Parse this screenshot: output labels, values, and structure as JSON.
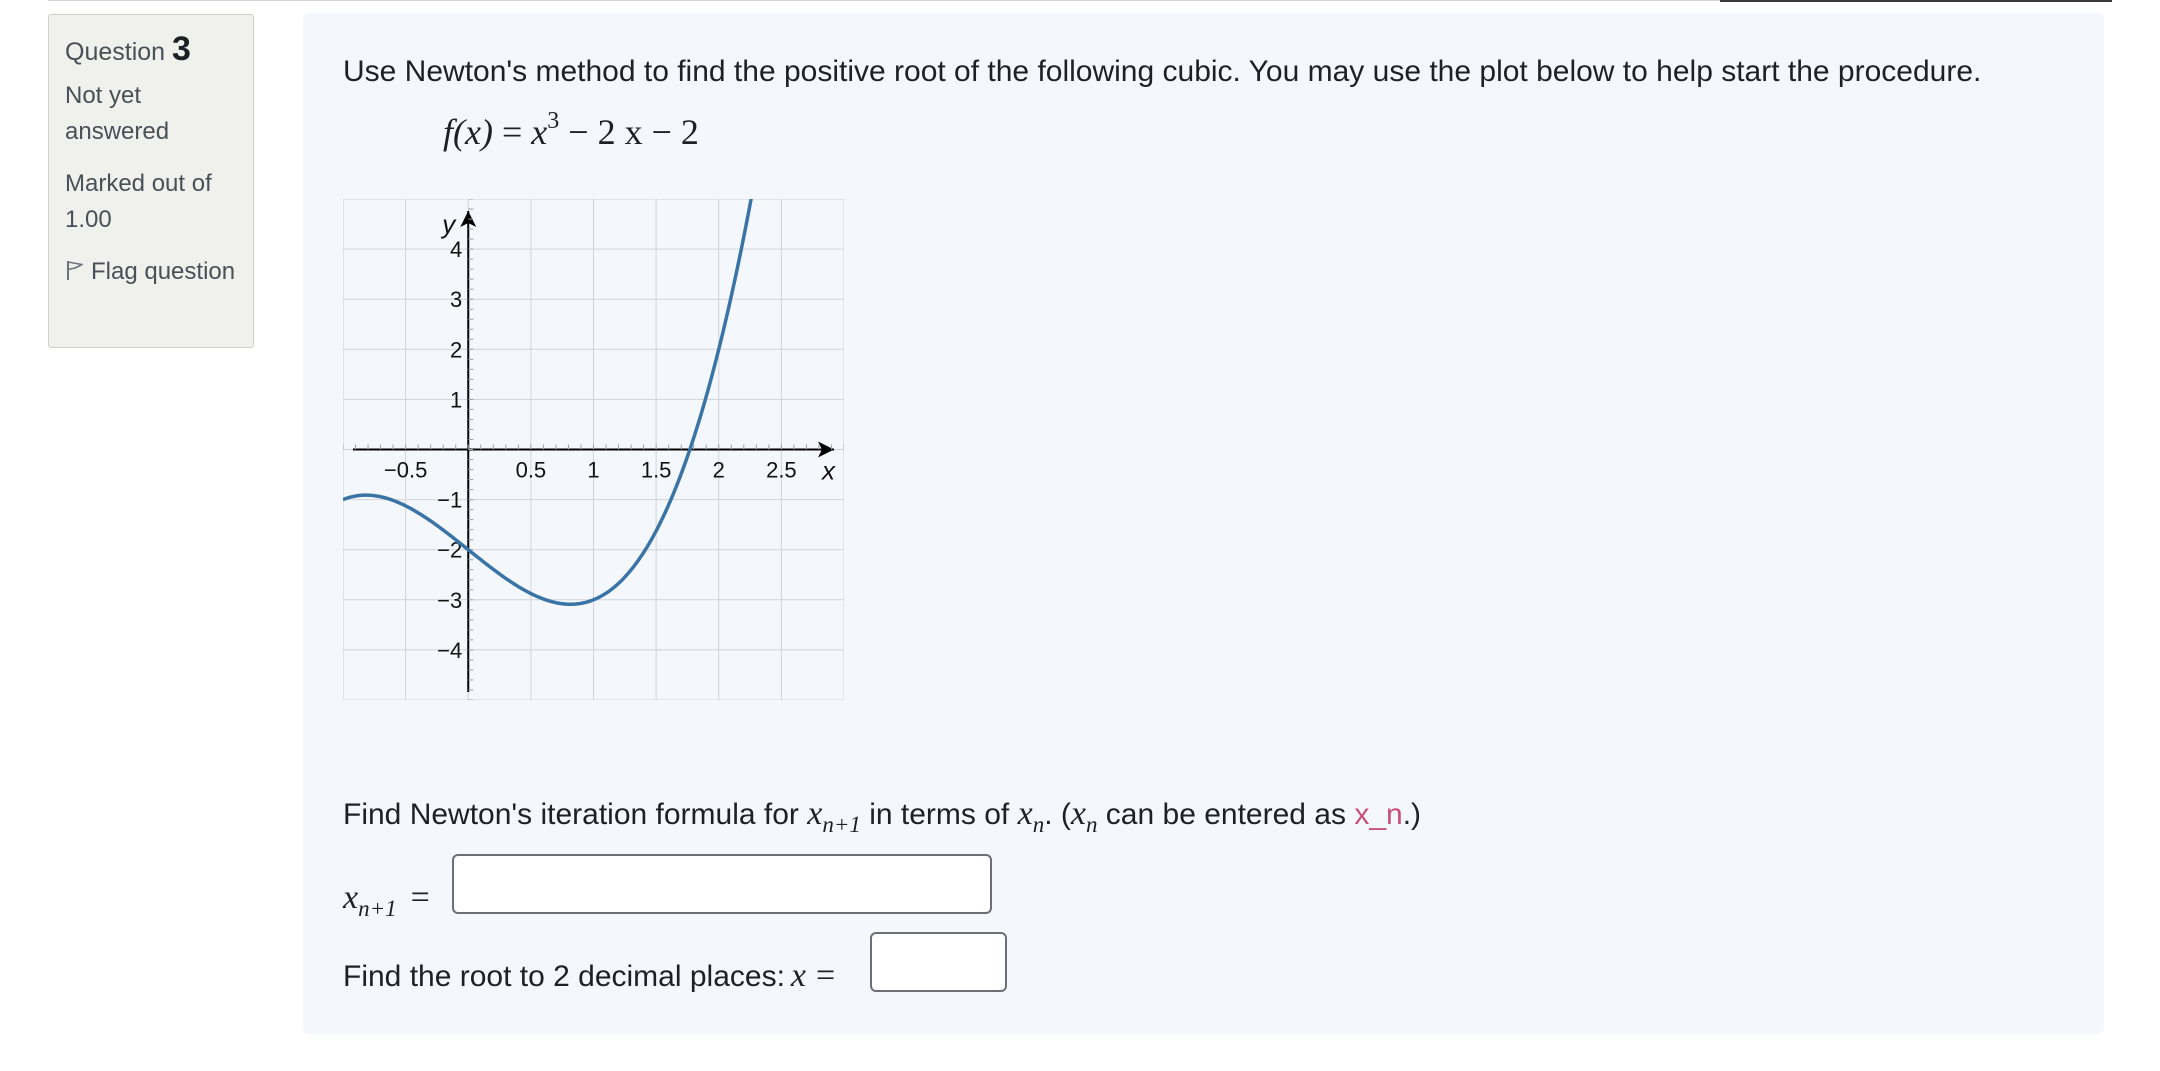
{
  "info": {
    "question_label": "Question",
    "question_number": "3",
    "state": "Not yet answered",
    "grade": "Marked out of 1.00",
    "flag_label": "Flag question"
  },
  "question": {
    "prompt": "Use Newton's method to find the positive root of the following cubic. You may use the plot below to help start the procedure.",
    "formula": {
      "lhs": "f(x)",
      "eq": "=",
      "x": "x",
      "exp": "3",
      "rest": " − 2 x − 2"
    },
    "part1": {
      "pre": "Find Newton's iteration formula for ",
      "var": "x",
      "var_sub": "n+1",
      "mid": " in terms of ",
      "var2": "x",
      "var2_sub": "n",
      "mid2": ". (",
      "var3": "x",
      "var3_sub": "n",
      "mid3": " can be entered as ",
      "code": "x_n",
      "post": ".)",
      "input_label": "x",
      "input_label_sub": "n+1",
      "eq": "=",
      "value": ""
    },
    "part2": {
      "text": "Find the root to 2 decimal places:",
      "var": "x",
      "eq": "=",
      "value": ""
    }
  },
  "chart_data": {
    "type": "line",
    "function": "x^3 - 2x - 2",
    "xlabel": "x",
    "ylabel": "y",
    "xlim": [
      -1.0,
      3.0
    ],
    "ylim": [
      -5.0,
      5.0
    ],
    "x_ticks": [
      "−0.5",
      "0.5",
      "1",
      "1.5",
      "2",
      "2.5"
    ],
    "x_tick_values": [
      -0.5,
      0.5,
      1,
      1.5,
      2,
      2.5
    ],
    "y_ticks": [
      "4",
      "3",
      "2",
      "1",
      "−1",
      "−2",
      "−3",
      "−4"
    ],
    "y_tick_values": [
      4,
      3,
      2,
      1,
      -1,
      -2,
      -3,
      -4
    ],
    "grid": true,
    "line_color": "#3a73a6"
  }
}
